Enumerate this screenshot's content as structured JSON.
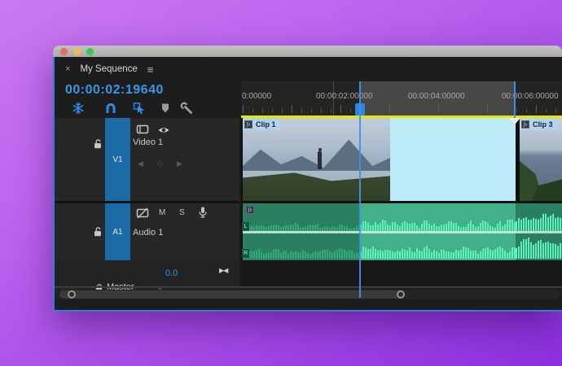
{
  "window": {
    "traffic_lights": [
      "#ee6a5e",
      "#f5bd4b",
      "#38c748"
    ]
  },
  "tab": {
    "close_glyph": "×",
    "title": "My Sequence",
    "menu_glyph": "≡"
  },
  "timecode": "00:00:02:19640",
  "toolbar": {
    "icons": [
      {
        "name": "nest-sequences",
        "active": true
      },
      {
        "name": "snap",
        "active": true
      },
      {
        "name": "linked-selection",
        "active": true
      },
      {
        "name": "add-marker",
        "active": false
      },
      {
        "name": "timeline-display-settings",
        "active": false
      }
    ]
  },
  "ruler": {
    "labels": [
      "0:00000",
      "00:00:02:00000",
      "00:00:04:00000",
      "00:00:06:00000"
    ]
  },
  "tracks": {
    "video": {
      "patch": "V1",
      "name": "Video 1"
    },
    "audio": {
      "patch": "A1",
      "name": "Audio 1",
      "mute_label": "M",
      "solo_label": "S"
    },
    "master": {
      "name": "Master",
      "volume": "0.0"
    }
  },
  "clips": {
    "clip1": {
      "fx_badge": "fx",
      "label": "Clip 1"
    },
    "clip3": {
      "fx_badge": "fx",
      "label": "Clip 3"
    },
    "audio_fx_badge": "fx",
    "audio_channel_left": "L",
    "audio_channel_right": "R"
  },
  "glyphs": {
    "prev_keyframe": "◀",
    "add_keyframe": "◇",
    "next_keyframe": "▶",
    "pan": "▶◀",
    "master_up": "▲"
  },
  "colors": {
    "accent_blue": "#2d8ce8",
    "selection_fill": "#bdeafb",
    "audio_clip": "#2b7f61",
    "audio_clip_highlight": "#42b189",
    "waveform": "#36a87e",
    "waveform_bright": "#5df0bb",
    "work_bar_yellow": "#e3e503",
    "patch_blue": "#1b6ba6"
  },
  "waveform_seed": 11
}
